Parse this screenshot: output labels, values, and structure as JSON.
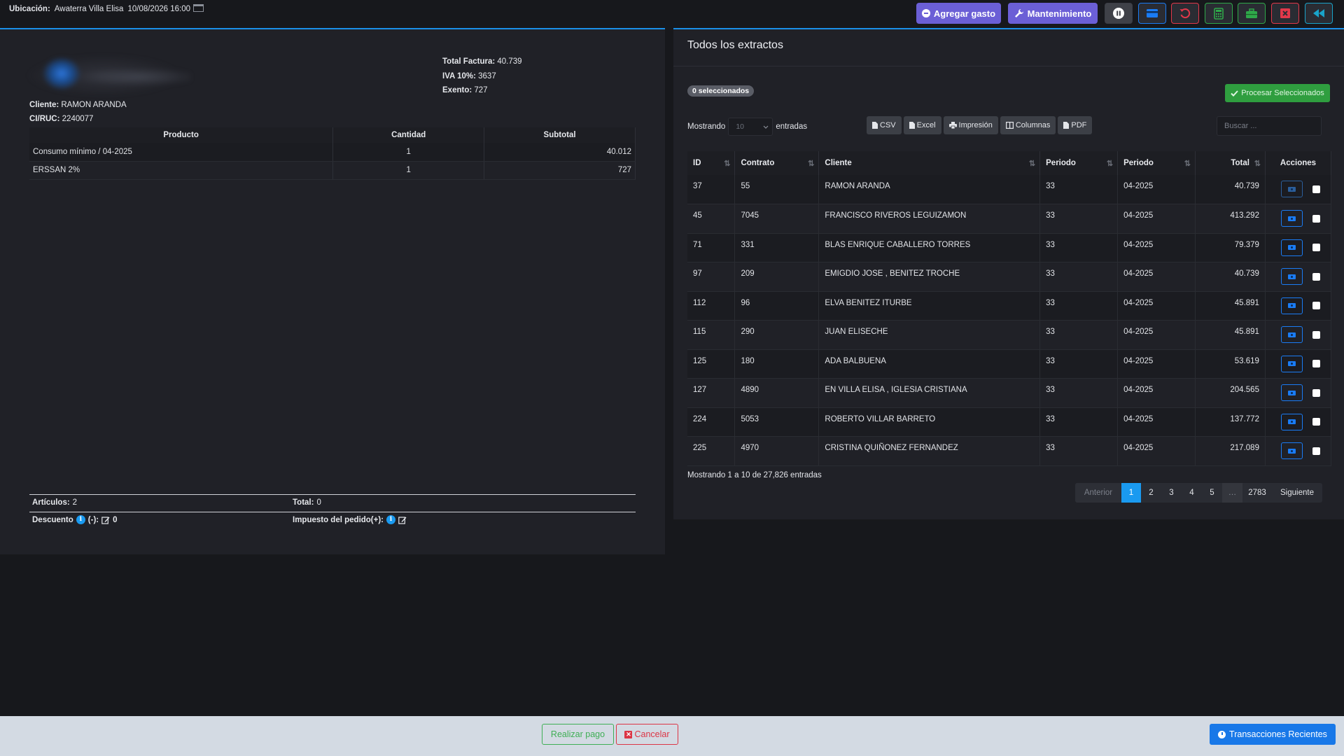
{
  "topbar": {
    "location_label": "Ubicación:",
    "location_value": "Awaterra Villa Elisa",
    "datetime": "10/08/2026 16:00",
    "agregar_gasto": "Agregar gasto",
    "mantenimiento": "Mantenimiento",
    "icons": [
      "pause-icon",
      "credit-card-icon",
      "undo-icon",
      "calculator-icon",
      "briefcase-icon",
      "close-window-icon",
      "fast-backward-icon"
    ]
  },
  "invoice": {
    "total_factura_label": "Total Factura:",
    "total_factura": "40.739",
    "iva_label": "IVA 10%:",
    "iva": "3637",
    "exento_label": "Exento:",
    "exento": "727",
    "cliente_label": "Cliente:",
    "cliente": "RAMON ARANDA",
    "ruc_label": "CI/RUC:",
    "ruc": "2240077",
    "columns": [
      "Producto",
      "Cantidad",
      "Subtotal"
    ],
    "rows": [
      {
        "producto": "Consumo mínimo / 04-2025",
        "cantidad": "1",
        "subtotal": "40.012"
      },
      {
        "producto": "ERSSAN 2%",
        "cantidad": "1",
        "subtotal": "727"
      }
    ],
    "articulos_label": "Artículos:",
    "articulos": "2",
    "total_label": "Total:",
    "total": "0",
    "descuento_label": "Descuento",
    "descuento_sign": "(-):",
    "descuento": "0",
    "impuesto_label": "Impuesto del pedido(+):"
  },
  "extractos": {
    "title": "Todos los extractos",
    "selected_badge": "0 seleccionados",
    "procesar": "Procesar Seleccionados",
    "mostrando_label": "Mostrando",
    "page_len": "10",
    "entradas_label": "entradas",
    "export_buttons": [
      "CSV",
      "Excel",
      "Impresión",
      "Columnas",
      "PDF"
    ],
    "search_placeholder": "Buscar ...",
    "columns": [
      "ID",
      "Contrato",
      "Cliente",
      "Periodo",
      "Periodo",
      "Total",
      "Acciones"
    ],
    "rows": [
      {
        "id": "37",
        "contrato": "55",
        "cliente": "RAMON ARANDA",
        "p1": "33",
        "p2": "04-2025",
        "total": "40.739"
      },
      {
        "id": "45",
        "contrato": "7045",
        "cliente": "FRANCISCO RIVEROS LEGUIZAMON",
        "p1": "33",
        "p2": "04-2025",
        "total": "413.292"
      },
      {
        "id": "71",
        "contrato": "331",
        "cliente": "BLAS ENRIQUE CABALLERO TORRES",
        "p1": "33",
        "p2": "04-2025",
        "total": "79.379"
      },
      {
        "id": "97",
        "contrato": "209",
        "cliente": "EMIGDIO JOSE , BENITEZ TROCHE",
        "p1": "33",
        "p2": "04-2025",
        "total": "40.739"
      },
      {
        "id": "112",
        "contrato": "96",
        "cliente": "ELVA BENITEZ ITURBE",
        "p1": "33",
        "p2": "04-2025",
        "total": "45.891"
      },
      {
        "id": "115",
        "contrato": "290",
        "cliente": "JUAN ELISECHE",
        "p1": "33",
        "p2": "04-2025",
        "total": "45.891"
      },
      {
        "id": "125",
        "contrato": "180",
        "cliente": "ADA BALBUENA",
        "p1": "33",
        "p2": "04-2025",
        "total": "53.619"
      },
      {
        "id": "127",
        "contrato": "4890",
        "cliente": "EN VILLA ELISA , IGLESIA CRISTIANA",
        "p1": "33",
        "p2": "04-2025",
        "total": "204.565"
      },
      {
        "id": "224",
        "contrato": "5053",
        "cliente": "ROBERTO VILLAR BARRETO",
        "p1": "33",
        "p2": "04-2025",
        "total": "137.772"
      },
      {
        "id": "225",
        "contrato": "4970",
        "cliente": "CRISTINA QUIÑONEZ FERNANDEZ",
        "p1": "33",
        "p2": "04-2025",
        "total": "217.089"
      }
    ],
    "info": "Mostrando 1 a 10 de 27,826 entradas",
    "pagination": {
      "prev": "Anterior",
      "pages": [
        "1",
        "2",
        "3",
        "4",
        "5"
      ],
      "ellipsis": "…",
      "last": "2783",
      "next": "Siguiente"
    }
  },
  "footer": {
    "realizar_pago": "Realizar pago",
    "cancelar": "Cancelar",
    "transacciones": "Transacciones Recientes"
  },
  "colors": {
    "accent_blue": "#1a8fe8",
    "purple": "#6b5fd6",
    "green": "#2f9e3f",
    "red": "#dc3545"
  }
}
